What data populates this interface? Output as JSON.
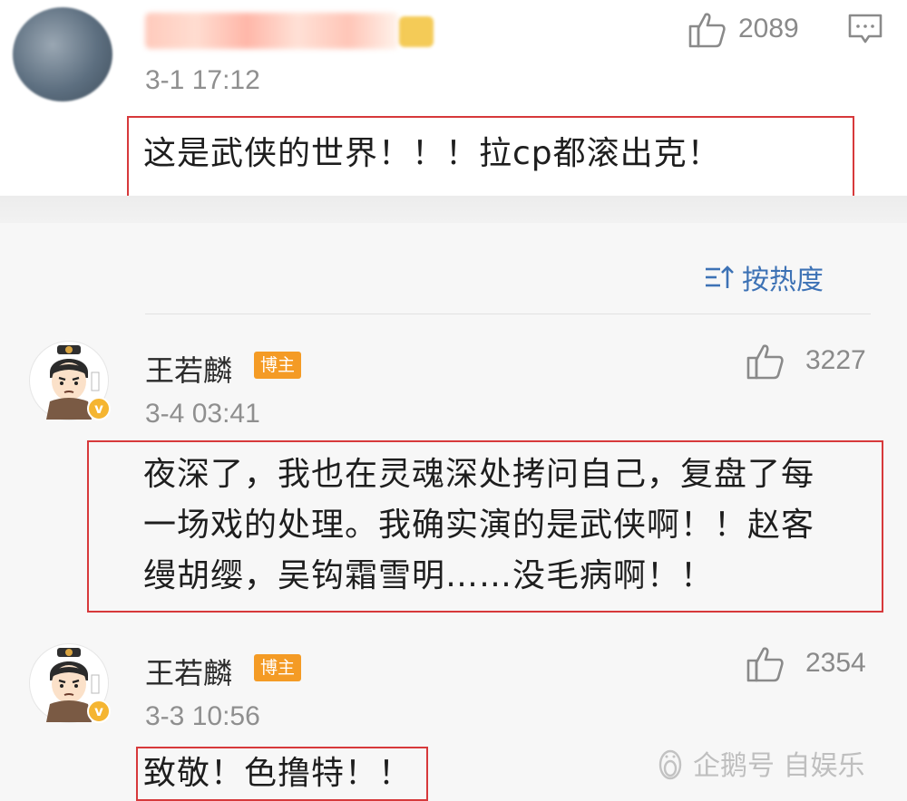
{
  "top_comment": {
    "time": "3-1 17:12",
    "likes": "2089",
    "text": "这是武侠的世界！！！拉cp都滚出克！"
  },
  "sort": {
    "label": "按热度"
  },
  "replies": [
    {
      "username": "王若麟",
      "tag": "博主",
      "time": "3-4 03:41",
      "likes": "3227",
      "lines": [
        "夜深了，我也在灵魂深处拷问自己，复盘了每",
        "一场戏的处理。我确实演的是武侠啊！！赵客",
        "缦胡缨，吴钩霜雪明……没毛病啊！！"
      ]
    },
    {
      "username": "王若麟",
      "tag": "博主",
      "time": "3-3 10:56",
      "likes": "2354",
      "text": "致敬！色撸特！！"
    }
  ],
  "watermark": {
    "text": "企鹅号 自娱乐"
  },
  "colors": {
    "highlight": "#d7393b",
    "link": "#3d72b5",
    "tag": "#f49b25",
    "verified": "#f5b531"
  }
}
